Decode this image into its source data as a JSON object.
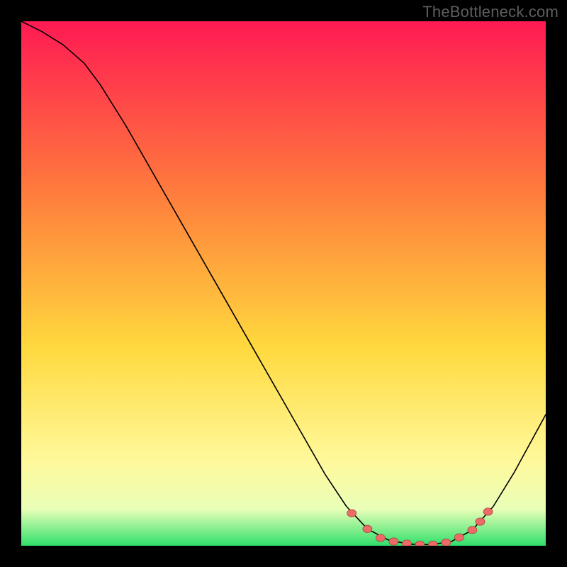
{
  "watermark": "TheBottleneck.com",
  "colors": {
    "background": "#000000",
    "gradient_top": "#ff1a53",
    "gradient_mid1": "#ff7a3d",
    "gradient_mid2": "#ffd93d",
    "gradient_mid3": "#fff99c",
    "gradient_bottom": "#2fe06b",
    "curve": "#000000",
    "marker": "#ed6b66",
    "watermark": "#5e5e5e"
  },
  "chart_data": {
    "type": "line",
    "title": "",
    "xlabel": "",
    "ylabel": "",
    "xlim": [
      0,
      100
    ],
    "ylim": [
      0,
      100
    ],
    "curve": [
      {
        "x": 0,
        "y": 100
      },
      {
        "x": 4,
        "y": 98
      },
      {
        "x": 8,
        "y": 95.5
      },
      {
        "x": 12,
        "y": 92
      },
      {
        "x": 15,
        "y": 88
      },
      {
        "x": 20,
        "y": 80
      },
      {
        "x": 28,
        "y": 66
      },
      {
        "x": 36,
        "y": 52
      },
      {
        "x": 44,
        "y": 38
      },
      {
        "x": 52,
        "y": 24
      },
      {
        "x": 58,
        "y": 13.5
      },
      {
        "x": 62,
        "y": 7.5
      },
      {
        "x": 66,
        "y": 3.2
      },
      {
        "x": 70,
        "y": 1.1
      },
      {
        "x": 74,
        "y": 0.3
      },
      {
        "x": 78,
        "y": 0.2
      },
      {
        "x": 82,
        "y": 0.8
      },
      {
        "x": 86,
        "y": 3.0
      },
      {
        "x": 90,
        "y": 7.5
      },
      {
        "x": 94,
        "y": 14
      },
      {
        "x": 100,
        "y": 25
      }
    ],
    "markers": [
      {
        "x": 63,
        "y": 6.2
      },
      {
        "x": 66,
        "y": 3.2
      },
      {
        "x": 68.5,
        "y": 1.5
      },
      {
        "x": 71,
        "y": 0.8
      },
      {
        "x": 73.5,
        "y": 0.4
      },
      {
        "x": 76,
        "y": 0.2
      },
      {
        "x": 78.5,
        "y": 0.2
      },
      {
        "x": 81,
        "y": 0.6
      },
      {
        "x": 83.5,
        "y": 1.6
      },
      {
        "x": 86,
        "y": 3.0
      },
      {
        "x": 87.5,
        "y": 4.6
      },
      {
        "x": 89,
        "y": 6.5
      }
    ]
  }
}
